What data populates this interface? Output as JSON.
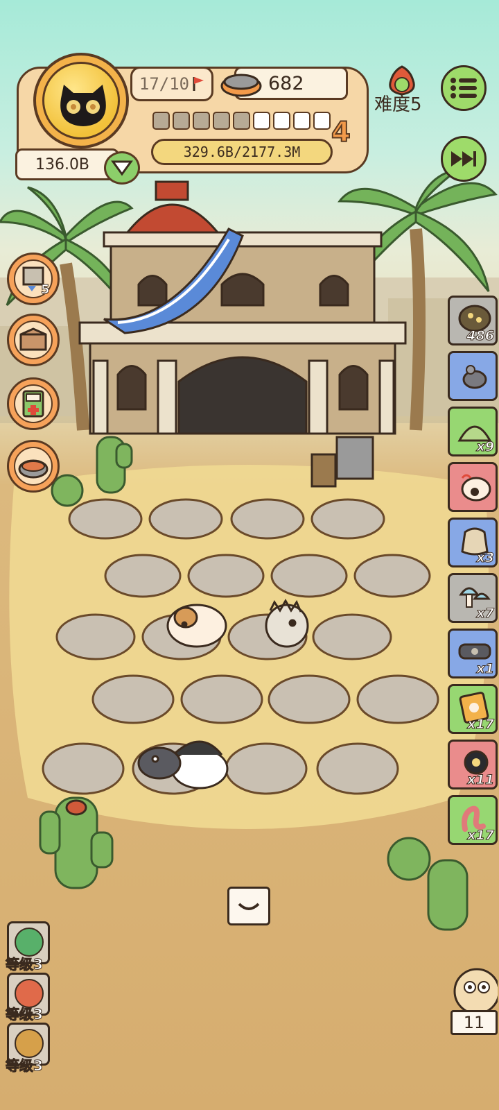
{
  "hud": {
    "flags": "17/10",
    "coins": "682",
    "money": "136.0B",
    "progress": "329.6B/2177.3M",
    "level": "4",
    "progress_segments_filled": 5,
    "progress_segments_total": 9,
    "difficulty": "难度5"
  },
  "side_buttons": [
    {
      "icon": "scroll-hourglass-icon",
      "badge": "5"
    },
    {
      "icon": "box-icon",
      "badge": ""
    },
    {
      "icon": "first-aid-kit-icon",
      "badge": ""
    },
    {
      "icon": "food-bowl-icon",
      "badge": ""
    }
  ],
  "inventory": [
    {
      "icon": "seed-pod-icon",
      "count": "486",
      "color": "gray"
    },
    {
      "icon": "mouse-toy-icon",
      "count": "",
      "color": "blue"
    },
    {
      "icon": "tent-icon",
      "count": "x9",
      "color": "green"
    },
    {
      "icon": "toy-bag-icon",
      "count": "",
      "color": "red"
    },
    {
      "icon": "grain-sack-icon",
      "count": "x3",
      "color": "blue"
    },
    {
      "icon": "mushroom-icon",
      "count": "x7",
      "color": "gray"
    },
    {
      "icon": "collar-icon",
      "count": "x1",
      "color": "blue"
    },
    {
      "icon": "snack-pack-icon",
      "count": "x17",
      "color": "green"
    },
    {
      "icon": "rope-toy-icon",
      "count": "x11",
      "color": "red"
    },
    {
      "icon": "worm-icon",
      "count": "x17",
      "color": "green"
    }
  ],
  "levels": [
    {
      "label": "等级3",
      "icon": "pot-icon",
      "color": "#58b06a"
    },
    {
      "label": "等级3",
      "icon": "meat-icon",
      "color": "#e06a4a"
    },
    {
      "label": "等级3",
      "icon": "cheese-icon",
      "color": "#d6a04a"
    }
  ],
  "pet": {
    "count": "11"
  }
}
